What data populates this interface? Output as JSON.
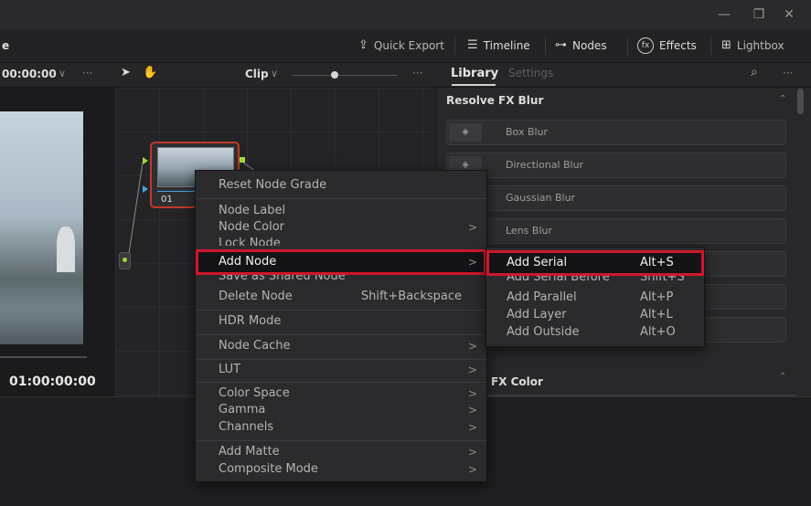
{
  "window": {
    "minimize": "—",
    "restore": "❐",
    "close": "✕"
  },
  "toolbar": {
    "page_letter": "e",
    "quick_export": "Quick Export",
    "timeline": "Timeline",
    "nodes": "Nodes",
    "effects": "Effects",
    "lightbox": "Lightbox"
  },
  "subbar": {
    "timecode": "00:00:00",
    "timecode_arrow": "∨",
    "more": "···",
    "clip_label": "Clip",
    "clip_arrow": "∨",
    "more2": "···",
    "tab_library": "Library",
    "tab_settings": "Settings",
    "search_icon": "🔍",
    "more3": "···"
  },
  "viewer": {
    "timecode": "01:00:00:00"
  },
  "node": {
    "label": "01"
  },
  "library": {
    "section1": "Resolve FX Blur",
    "items": [
      "Box Blur",
      "Directional Blur",
      "Gaussian Blur",
      "Lens Blur"
    ],
    "section2": "FX Color"
  },
  "context_menu": {
    "reset": "Reset Node Grade",
    "node_label": "Node Label",
    "node_color": "Node Color",
    "lock_node": "Lock Node",
    "add_node": "Add Node",
    "save_shared": "Save as Shared Node",
    "delete_node": "Delete Node",
    "delete_shortcut": "Shift+Backspace",
    "hdr_mode": "HDR Mode",
    "node_cache": "Node Cache",
    "lut": "LUT",
    "color_space": "Color Space",
    "gamma": "Gamma",
    "channels": "Channels",
    "add_matte": "Add Matte",
    "composite_mode": "Composite Mode",
    "arrow": ">"
  },
  "submenu": {
    "add_serial": "Add Serial",
    "add_serial_sc": "Alt+S",
    "add_serial_before": "Add Serial Before",
    "add_serial_before_sc": "Shift+S",
    "add_parallel": "Add Parallel",
    "add_parallel_sc": "Alt+P",
    "add_layer": "Add Layer",
    "add_layer_sc": "Alt+L",
    "add_outside": "Add Outside",
    "add_outside_sc": "Alt+O"
  },
  "colors": {
    "highlight_border": "#d0182b",
    "node_border": "#c0392b",
    "input_dot": "#9bdc3a"
  }
}
